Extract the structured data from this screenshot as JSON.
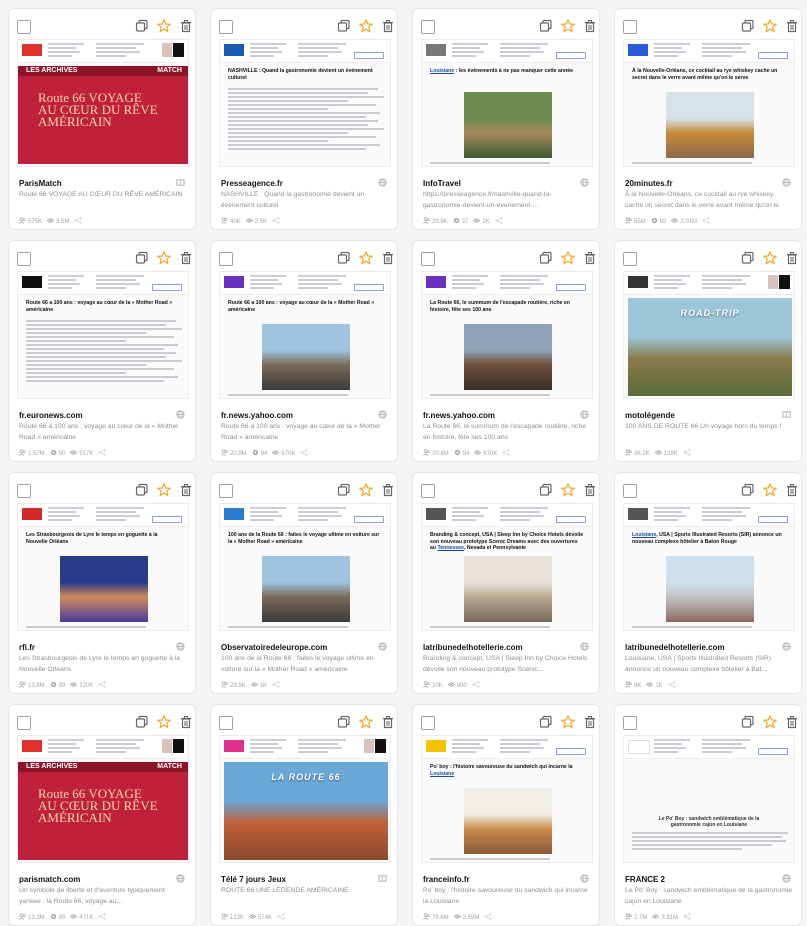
{
  "colors": {
    "accent": "#f5a623",
    "text": "#222222",
    "muted": "#8a8f98",
    "link": "#1a4fa0",
    "magazine_red": "#c0213a"
  },
  "cards": [
    {
      "source": "ParisMatch",
      "description": "Route 66 VOYAGE AU CŒUR DU RÊVE AMÉRICAIN",
      "stats": [
        "575K",
        "3.5M"
      ],
      "thumb": "magazine",
      "mag_label": "LES ARCHIVES",
      "mag_label2": "MATCH",
      "mag_headline": "Route 66 VOYAGE AU CŒUR DU RÊVE AMÉRICAIN",
      "logo_color": "#e03030",
      "source_icon": "book-icon"
    },
    {
      "source": "Presseagence.fr",
      "description": "NASHVILLE : Quand la gastronomie devient un événement culturel",
      "stats": [
        "40K",
        "2.5K"
      ],
      "thumb": "article",
      "headline": "NASHVILLE : Quand la gastronomie devient un événement culturel",
      "logo_color": "#1a5ab0",
      "source_icon": "globe-icon"
    },
    {
      "source": "InfoTravel",
      "description": "https://presseagence.fr/nashville-quand-la-gastronomie-devient-un-evenement-...",
      "stats": [
        "29.8K",
        "37",
        "1K"
      ],
      "thumb": "article-photo",
      "headline": "Louisiane : les évènements à ne pas manquer cette année",
      "highlight": "Louisiane",
      "photo_colors": [
        "#6d8c4e",
        "#a78a5c",
        "#3e5a34"
      ],
      "logo_color": "#777777",
      "source_icon": "globe-icon"
    },
    {
      "source": "20minutes.fr",
      "description": "À la Nouvelle-Orléans, ce cocktail au rye whiskey cache un secret dans le verre avant même qu'on le serve",
      "stats": [
        "65M",
        "92",
        "2.01M"
      ],
      "thumb": "article-photo",
      "headline": "À la Nouvelle-Orléans, ce cocktail au rye whiskey cache un secret dans le verre avant même qu'on le serve",
      "photo_colors": [
        "#d7e3ea",
        "#c98a3a",
        "#8a6a4a"
      ],
      "logo_color": "#2a5bd7",
      "source_icon": "globe-icon"
    },
    {
      "source": "fr.euronews.com",
      "description": "Route 66 a 100 ans : voyage au cœur de la « Mother Road » américaine",
      "stats": [
        "1.57M",
        "90",
        "517K"
      ],
      "thumb": "article",
      "headline": "Route 66 a 100 ans : voyage au cœur de la « Mother Road » américaine",
      "logo_color": "#111111",
      "source_icon": "globe-icon"
    },
    {
      "source": "fr.news.yahoo.com",
      "description": "Route 66 a 100 ans : voyage au cœur de la « Mother Road » américaine",
      "stats": [
        "20.8M",
        "94",
        "670K"
      ],
      "thumb": "article-photo",
      "headline": "Route 66 a 100 ans : voyage au cœur de la « Mother Road » américaine",
      "photo_colors": [
        "#9fc3e0",
        "#7a6a5a",
        "#3b3b3b"
      ],
      "logo_color": "#6b2fbf",
      "source_icon": "globe-icon"
    },
    {
      "source": "fr.news.yahoo.com",
      "description": "La Route 66, le summum de l'escapade routière, riche en histoire, fête ses 100 ans",
      "stats": [
        "20.8M",
        "94",
        "670K"
      ],
      "thumb": "article-photo",
      "headline": "La Route 66, le summum de l'escapade routière, riche en histoire, fête ses 100 ans",
      "photo_colors": [
        "#8fa3b8",
        "#6e4f3c",
        "#3a2e28"
      ],
      "logo_color": "#6b2fbf",
      "source_icon": "globe-icon"
    },
    {
      "source": "motolégende",
      "description": "100 ANS DE ROUTE 66 Un voyage hors du temps !",
      "stats": [
        "38.2K",
        "138K"
      ],
      "thumb": "photo",
      "photo_colors": [
        "#9cc6d8",
        "#8a7a4a",
        "#5a6b3a"
      ],
      "photo_label": "ROAD-TRIP",
      "logo_color": "#333333",
      "source_icon": "book-icon"
    },
    {
      "source": "rfi.fr",
      "description": "Les Strasbourgeois de Lyre le temps en goguette à la Nouvelle Orléans",
      "stats": [
        "13.8M",
        "89",
        "320K"
      ],
      "thumb": "article-photo",
      "headline": "Les Strasbourgeois de Lyre le temps en goguette à la Nouvelle Orléans",
      "photo_colors": [
        "#2a3b8a",
        "#d28a5a",
        "#4a3aa0"
      ],
      "logo_color": "#d42a2a",
      "source_icon": "globe-icon"
    },
    {
      "source": "Observatoiredeleurope.com",
      "description": "100 ans de la Route 66 : faites le voyage ultime en voiture sur la « Mother Road » américaine",
      "stats": [
        "28.5K",
        "1K"
      ],
      "thumb": "article-photo",
      "headline": "100 ans de la Route 66 : faites le voyage ultime en voiture sur la « Mother Road » américaine",
      "photo_colors": [
        "#9fc3e0",
        "#7a6a5a",
        "#3b3b3b"
      ],
      "logo_color": "#2a7bd0",
      "source_icon": "globe-icon"
    },
    {
      "source": "latribunedelhotellerie.com",
      "description": "Branding & concept, USA | Sleep Inn by Choice Hotels dévoile son nouveau prototype Scenic...",
      "stats": [
        "10K",
        "900"
      ],
      "thumb": "article-photo",
      "headline": "Branding & concept, USA | Sleep Inn by Choice Hotels dévoile son nouveau prototype Scenic Dreams avec des ouvertures au Tennessee, Nevada et Pennsylvanie",
      "highlight": "Tennessee",
      "photo_colors": [
        "#e8e2d8",
        "#b8a890",
        "#7a6a5a"
      ],
      "logo_color": "#555555",
      "source_icon": "globe-icon"
    },
    {
      "source": "latribunedelhotellerie.com",
      "description": "Louisiane, USA | Sports Illustrated Resorts (SIR) annonce un nouveau complexe hôtelier à Bat...",
      "stats": [
        "9K",
        "1K"
      ],
      "thumb": "article-photo",
      "headline": "Louisiane, USA | Sports Illustrated Resorts (SIR) annonce un nouveau complexe hôtelier à Baton Rouge",
      "highlight": "Louisiane",
      "photo_colors": [
        "#cfe0ee",
        "#c2c4c8",
        "#8a6a5a"
      ],
      "logo_color": "#555555",
      "source_icon": "globe-icon"
    },
    {
      "source": "parismatch.com",
      "description": "Un symbole de liberté et d'aventure typiquement yankee : la Route 66, voyage au...",
      "stats": [
        "13.3M",
        "85",
        "471K"
      ],
      "thumb": "magazine",
      "mag_label": "LES ARCHIVES",
      "mag_label2": "MATCH",
      "mag_headline": "Route 66 VOYAGE AU CŒUR DU RÊVE AMÉRICAIN",
      "logo_color": "#e03030",
      "source_icon": "globe-icon"
    },
    {
      "source": "Télé 7 jours Jeux",
      "description": "ROUTE 66 UNE LÉGENDE AMÉRICAINE",
      "stats": [
        "123K",
        "574K"
      ],
      "thumb": "photo",
      "photo_colors": [
        "#6aa8d8",
        "#c2603a",
        "#8a4a2a"
      ],
      "photo_label": "LA ROUTE 66",
      "logo_color": "#e03090",
      "source_icon": "book-icon"
    },
    {
      "source": "franceinfo.fr",
      "description": "Po' boy : l'histoire savoureuse du sandwich qui incarne la Louisiane",
      "stats": [
        "78.6M",
        "2.59M"
      ],
      "thumb": "article-photo",
      "headline": "Po' boy : l'histoire savoureuse du sandwich qui incarne la Louisiane",
      "highlight": "Louisiane",
      "photo_colors": [
        "#f2efe8",
        "#c98a4a",
        "#8a5a3a"
      ],
      "logo_color": "#f2c400",
      "source_icon": "globe-icon"
    },
    {
      "source": "FRANCE 2",
      "description": "Le Po' Boy : sandwich emblématique de la gastronomie cajun en Louisiane",
      "stats": [
        "2.7M",
        "3.81M"
      ],
      "thumb": "transcript",
      "headline": "Le Po' Boy : sandwich emblématique de la gastronomie cajun en Louisiane",
      "logo_color": "#ffffff",
      "source_icon": "globe-icon"
    }
  ]
}
